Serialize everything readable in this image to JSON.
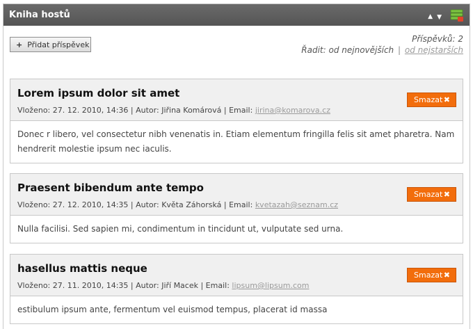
{
  "window": {
    "title": "Kniha hostů",
    "arrow_up": "▲",
    "arrow_down": "▼",
    "icon": "database-stack-icon"
  },
  "toolbar": {
    "add_label": "Přidat příspěvek",
    "plus": "+",
    "count_text": "Příspěvků: 2",
    "sort_label": "Řadit:",
    "sort_newest": "od nejnovějších",
    "separator": "|",
    "sort_oldest": "od nejstarších"
  },
  "delete_label": "Smazat",
  "delete_x": "✖",
  "posts": [
    {
      "title": "Lorem ipsum dolor sit amet",
      "meta": "Vloženo: 27. 12. 2010, 14:36 | Autor: Jiřina Komárová | Email: ",
      "email": "jirina@komarova.cz",
      "body": "Donec r libero, vel consectetur nibh venenatis in. Etiam elementum fringilla felis sit amet pharetra. Nam hendrerit molestie ipsum nec iaculis."
    },
    {
      "title": "Praesent bibendum ante tempo",
      "meta": "Vloženo: 27. 12. 2010, 14:35 | Autor: Květa Záhorská | Email: ",
      "email": "kvetazah@seznam.cz",
      "body": "Nulla facilisi. Sed sapien mi, condimentum in tincidunt ut, vulputate sed urna."
    },
    {
      "title": "hasellus mattis neque",
      "meta": "Vloženo: 27. 11. 2010, 14:35 | Autor: Jiří Macek | Email: ",
      "email": "lipsum@lipsum.com",
      "body": "estibulum ipsum ante, fermentum vel euismod tempus, placerat id massa"
    }
  ],
  "colors": {
    "titlebar": "#5f5f5f",
    "delete_button": "#f26d0c",
    "post_header": "#f0f0f0"
  }
}
